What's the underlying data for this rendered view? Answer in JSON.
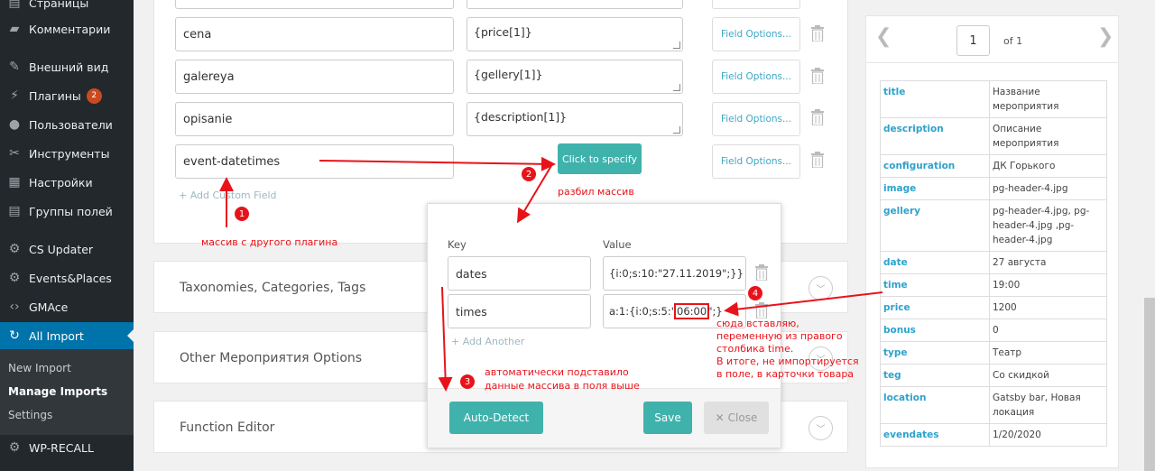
{
  "sidebar": {
    "items": [
      {
        "label": "Страницы",
        "icon": "pages-icon"
      },
      {
        "label": "Комментарии",
        "icon": "comments-icon"
      },
      {
        "label": "Внешний вид",
        "icon": "appearance-icon"
      },
      {
        "label": "Плагины",
        "icon": "plugins-icon",
        "badge": "2"
      },
      {
        "label": "Пользователи",
        "icon": "users-icon"
      },
      {
        "label": "Инструменты",
        "icon": "tools-icon"
      },
      {
        "label": "Настройки",
        "icon": "settings-icon"
      },
      {
        "label": "Группы полей",
        "icon": "field-groups-icon"
      },
      {
        "label": "CS Updater",
        "icon": "gear-icon"
      },
      {
        "label": "Events&Places",
        "icon": "gear-icon"
      },
      {
        "label": "GMAce",
        "icon": "code-icon"
      },
      {
        "label": "All Import",
        "icon": "all-import-icon"
      },
      {
        "label": "WP-RECALL",
        "icon": "gear-icon"
      }
    ],
    "submenu": [
      "New Import",
      "Manage Imports",
      "Settings"
    ]
  },
  "fields": [
    {
      "name": "cena",
      "value": "{price[1]}",
      "options_label": "Field Options..."
    },
    {
      "name": "galereya",
      "value": "{gellery[1]}",
      "options_label": "Field Options..."
    },
    {
      "name": "opisanie",
      "value": "{description[1]}",
      "options_label": "Field Options..."
    },
    {
      "name": "event-datetimes",
      "specify_label": "Click to specify",
      "options_label": "Field Options..."
    }
  ],
  "add_custom_field": "+ Add Custom Field",
  "accordions": [
    "Taxonomies, Categories, Tags",
    "Other Мероприятия Options",
    "Function Editor"
  ],
  "popup": {
    "key_header": "Key",
    "value_header": "Value",
    "rows": [
      {
        "key": "dates",
        "value": "{i:0;s:10:\"27.11.2019\";}}"
      },
      {
        "key": "times",
        "value_pre": "a:1:{i:0;s:5:\"",
        "value_hl": "06:00",
        "value_post": "\";}"
      }
    ],
    "add_another": "+ Add Another",
    "auto_detect": "Auto-Detect",
    "save": "Save",
    "close": "Close"
  },
  "pager": {
    "page": "1",
    "of": "of 1"
  },
  "record": [
    {
      "k": "title",
      "v": "Название мероприятия"
    },
    {
      "k": "description",
      "v": "Описание мероприятия"
    },
    {
      "k": "configuration",
      "v": "ДК Горького"
    },
    {
      "k": "image",
      "v": "pg-header-4.jpg"
    },
    {
      "k": "gellery",
      "v": "pg-header-4.jpg, pg-header-4.jpg ,pg-header-4.jpg"
    },
    {
      "k": "date",
      "v": "27 августа"
    },
    {
      "k": "time",
      "v": "19:00"
    },
    {
      "k": "price",
      "v": "1200"
    },
    {
      "k": "bonus",
      "v": "0"
    },
    {
      "k": "type",
      "v": "Театр"
    },
    {
      "k": "teg",
      "v": "Со скидкой"
    },
    {
      "k": "location",
      "v": "Gatsby bar, Новая локация"
    },
    {
      "k": "evendates",
      "v": "1/20/2020"
    }
  ],
  "annotations": {
    "n1": "1",
    "t1": "массив с другого плагина",
    "n2": "2",
    "t2": "разбил массив",
    "n3": "3",
    "t3a": "автоматически подставило",
    "t3b": "данные массива в поля выше",
    "n4": "4",
    "t4": [
      "сюда вставляю,",
      "переменную из правого",
      "столбика time.",
      "В итоге, не импортируется",
      "в поле, в карточки товара"
    ]
  },
  "colors": {
    "sidebar": "#23282d",
    "active": "#0073aa",
    "teal": "#40b2ac",
    "link": "#2ea2cc",
    "annotation": "#e8131a"
  }
}
